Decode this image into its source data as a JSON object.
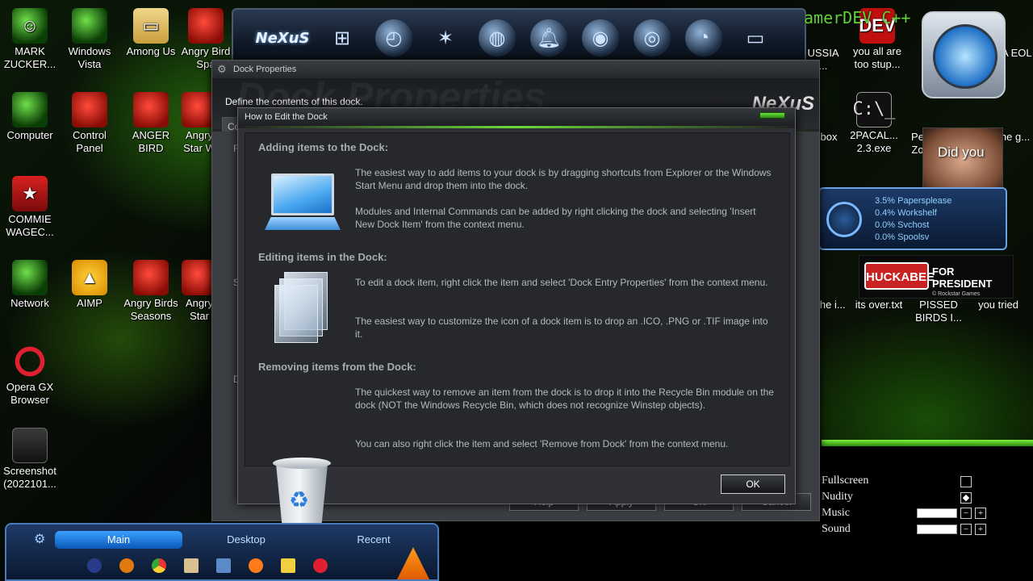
{
  "desktop_icons": [
    {
      "label": "MARK ZUCKER...",
      "icon": "person-green-icon"
    },
    {
      "label": "Windows Vista",
      "icon": "vista-orb-icon"
    },
    {
      "label": "Among Us",
      "icon": "folder-icon"
    },
    {
      "label": "Angry Bird Spa",
      "icon": "angry-birds-icon"
    },
    {
      "label": "Computer",
      "icon": "computer-icon"
    },
    {
      "label": "Control Panel",
      "icon": "control-panel-icon"
    },
    {
      "label": "ANGER BIRD",
      "icon": "angry-bird-icon"
    },
    {
      "label": "Angry Star W",
      "icon": "angry-birds-star-wars-icon"
    },
    {
      "label": "COMMIE WAGEC...",
      "icon": "commie-icon"
    },
    {
      "label": "Network",
      "icon": "network-icon"
    },
    {
      "label": "AIMP",
      "icon": "aimp-icon"
    },
    {
      "label": "Angry Birds Seasons",
      "icon": "angry-birds-seasons-icon"
    },
    {
      "label": "Angry Star",
      "icon": "angry-birds-star-icon"
    },
    {
      "label": "Opera GX Browser",
      "icon": "opera-gx-icon"
    },
    {
      "label": "Screenshot (2022101...",
      "icon": "screenshot-icon"
    },
    {
      "label": "USSIA ...",
      "icon": "red-icon"
    },
    {
      "label": "you all are too stup...",
      "icon": "devcpp-icon"
    },
    {
      "label": "IA EOL",
      "icon": "icon"
    },
    {
      "label": "box",
      "icon": "icon"
    },
    {
      "label": "2PACAL... 2.3.exe",
      "icon": "terminal-icon"
    },
    {
      "label": "Pe Zo",
      "icon": "icon"
    },
    {
      "label": "he g...",
      "icon": "angry-birds-icon"
    },
    {
      "label": "the i...",
      "icon": "angry-birds-icon"
    },
    {
      "label": "its over.txt",
      "icon": "text-file-icon"
    },
    {
      "label": "PISSED BIRDS I...",
      "icon": "icon"
    },
    {
      "label": "you tried",
      "icon": "icon"
    }
  ],
  "top_dock": {
    "brand": "NeXuS",
    "items": [
      "windows-logo-icon",
      "clock-icon",
      "shield-icon",
      "globe-icon",
      "bell-icon",
      "webcam-icon",
      "camera-lens-icon",
      "browser-icon",
      "monitor-icon"
    ]
  },
  "widgets": {
    "gamer_logo": "amerDEV C++",
    "devcpp_badge": "DEV",
    "face_caption": "Did you",
    "sysmon_rows": [
      "3.5% Papersplease",
      "0.4% Workshelf",
      "0.0% Svchost",
      "0.0% Spoolsv"
    ],
    "huckabee_name": "HUCKABEE",
    "huckabee_slogan": "FOR PRESIDENT",
    "huckabee_footer": "© Rockstar Games"
  },
  "dock_properties": {
    "title": "Dock Properties",
    "watermark": "Dock Properties",
    "define_text": "Define the contents of this dock.",
    "brand": "NeXuS",
    "tab_label": "Con",
    "left_letters": [
      "R",
      "S",
      "D"
    ],
    "buttons": [
      "Help",
      "Apply",
      "OK",
      "Cancel"
    ]
  },
  "howto_dialog": {
    "title": "How to Edit the Dock",
    "sections": [
      {
        "heading": "Adding items to the Dock:",
        "illustration": "monitor-icon",
        "paragraphs": [
          "The easiest way to add items to your dock is by dragging shortcuts from Explorer or the Windows Start Menu and drop them into the dock.",
          "Modules and Internal Commands can be added by right clicking the dock and selecting 'Insert New Dock Item' from the context menu."
        ]
      },
      {
        "heading": "Editing items in the Dock:",
        "illustration": "glass-panes-icon",
        "paragraphs": [
          "To edit a dock item, right click the item and select  'Dock Entry Properties' from the context menu.",
          "The easiest way to customize  the icon of a dock item is to drop an .ICO, .PNG or .TIF image into it."
        ]
      },
      {
        "heading": "Removing items from the Dock:",
        "illustration": "recycle-bin-icon",
        "paragraphs": [
          "The quickest way to remove an item from the dock is to drop it into the Recycle Bin module on the dock (NOT the Windows Recycle Bin, which does not recognize Winstep objects).",
          "You can also right click the item and select 'Remove from Dock' from the context menu."
        ]
      }
    ],
    "ok_label": "OK"
  },
  "settings_panel": {
    "rows": [
      {
        "label": "Fullscreen",
        "checked": false
      },
      {
        "label": "Nudity",
        "checked": true
      },
      {
        "label": "Music",
        "minus": "−",
        "plus": "+"
      },
      {
        "label": "Sound",
        "minus": "−",
        "plus": "+"
      }
    ],
    "check_mark": "◆"
  },
  "start_panel": {
    "tabs": [
      "Main",
      "Desktop",
      "Recent"
    ],
    "active_tab": "Main",
    "pinned": [
      "winstep-icon",
      "search-icon",
      "chrome-icon",
      "book-icon",
      "explorer-icon",
      "firefox-icon",
      "folder-icon",
      "opera-icon",
      "vlc-icon"
    ]
  }
}
